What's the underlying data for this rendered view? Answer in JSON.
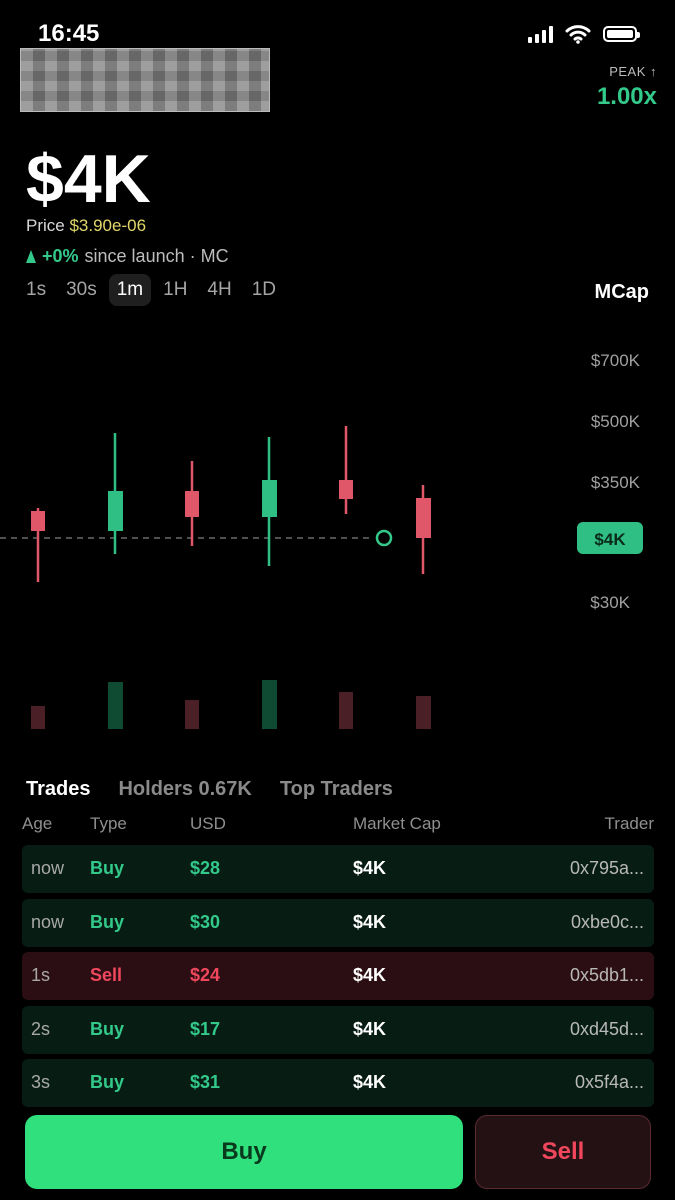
{
  "status_bar": {
    "time": "16:45"
  },
  "peak": {
    "label": "PEAK ↑",
    "value": "1.00x"
  },
  "market_cap": "$4K",
  "price": {
    "label": "Price",
    "value": "$3.90e-06"
  },
  "change": {
    "pct": "+0%",
    "suffix": "since launch · MC"
  },
  "timeframes": [
    "1s",
    "30s",
    "1m",
    "1H",
    "4H",
    "1D"
  ],
  "active_timeframe": "1m",
  "chart_toggle": "MCap",
  "chart": {
    "y_labels": [
      "$700K",
      "$500K",
      "$350K",
      "$4K",
      "$30K"
    ],
    "current_label": "$4K",
    "up_color": "#2fbf84",
    "down_color": "#e0576a",
    "candles": [
      {
        "dir": "down"
      },
      {
        "dir": "up"
      },
      {
        "dir": "down"
      },
      {
        "dir": "up"
      },
      {
        "dir": "down"
      },
      {
        "dir": "down"
      }
    ]
  },
  "tabs": [
    "Trades",
    "Holders 0.67K",
    "Top Traders"
  ],
  "table_headers": {
    "age": "Age",
    "type": "Type",
    "usd": "USD",
    "mc": "Market Cap",
    "trader": "Trader"
  },
  "trades": [
    {
      "age": "now",
      "type": "Buy",
      "usd": "$28",
      "mc": "$4K",
      "trader": "0x795a..."
    },
    {
      "age": "now",
      "type": "Buy",
      "usd": "$30",
      "mc": "$4K",
      "trader": "0xbe0c..."
    },
    {
      "age": "1s",
      "type": "Sell",
      "usd": "$24",
      "mc": "$4K",
      "trader": "0x5db1..."
    },
    {
      "age": "2s",
      "type": "Buy",
      "usd": "$17",
      "mc": "$4K",
      "trader": "0xd45d..."
    },
    {
      "age": "3s",
      "type": "Buy",
      "usd": "$31",
      "mc": "$4K",
      "trader": "0x5f4a..."
    }
  ],
  "actions": {
    "buy": "Buy",
    "sell": "Sell"
  }
}
